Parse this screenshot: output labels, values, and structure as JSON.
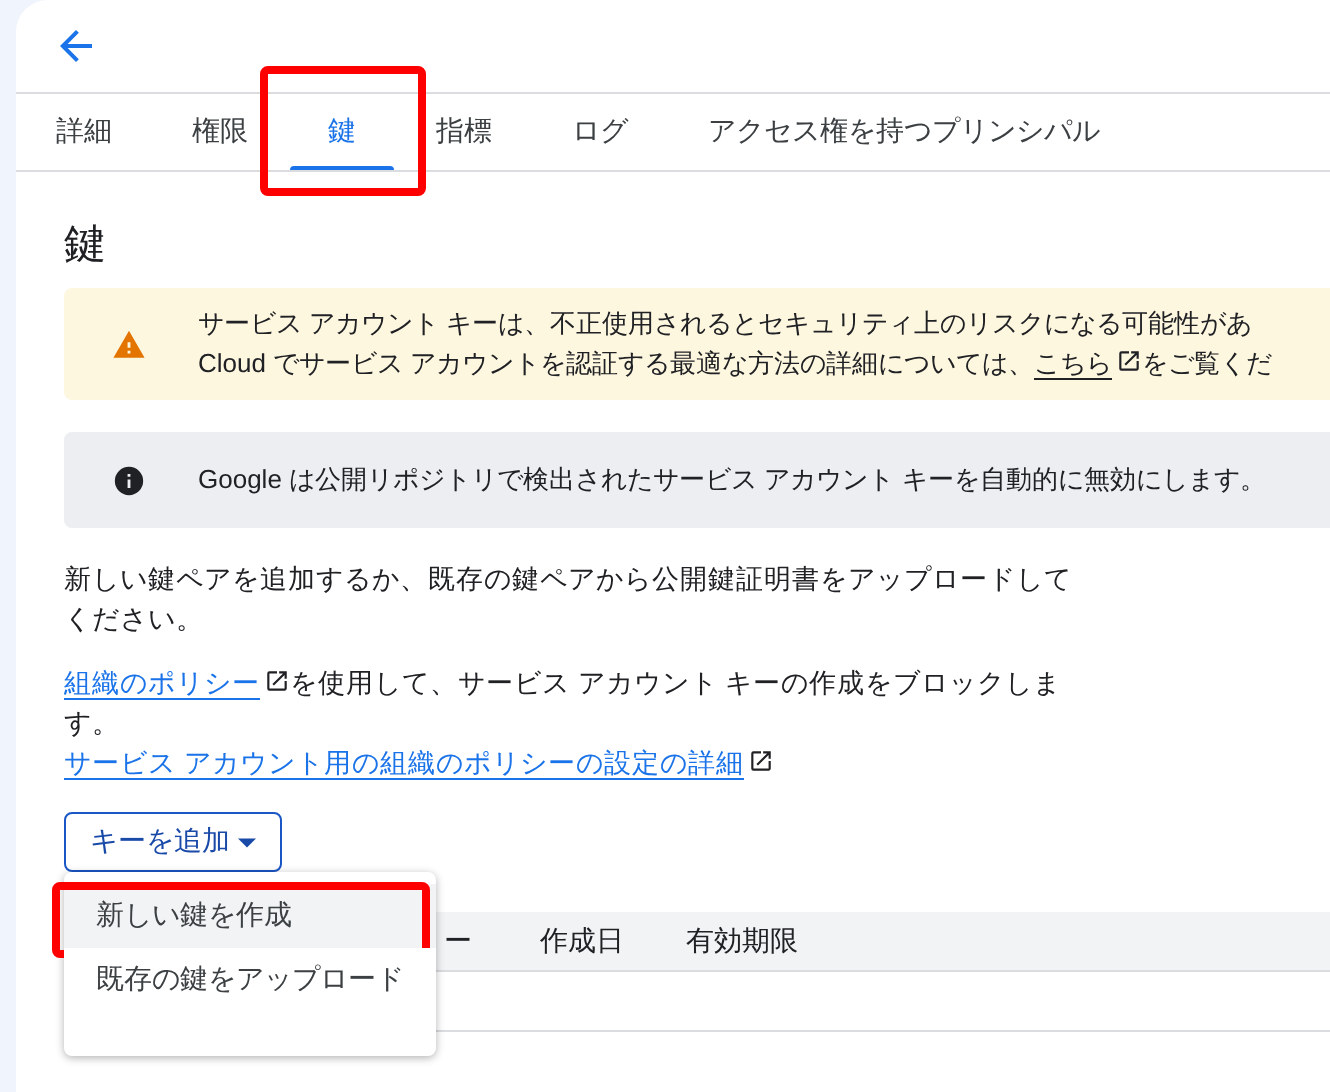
{
  "tabs": [
    {
      "label": "詳細",
      "selected": false,
      "highlighted": false
    },
    {
      "label": "権限",
      "selected": false,
      "highlighted": false
    },
    {
      "label": "鍵",
      "selected": true,
      "highlighted": true
    },
    {
      "label": "指標",
      "selected": false,
      "highlighted": false
    },
    {
      "label": "ログ",
      "selected": false,
      "highlighted": false
    },
    {
      "label": "アクセス権を持つプリンシパル",
      "selected": false,
      "highlighted": false
    }
  ],
  "heading": "鍵",
  "banners": [
    {
      "kind": "warning",
      "lines": [
        {
          "text": "サービス アカウント キーは、不正使用されるとセキュリティ上のリスクになる可能性があ"
        },
        {
          "text": "Cloud でサービス アカウントを認証する最適な方法の詳細については、",
          "link": "こちら",
          "after": "をご覧くだ"
        }
      ]
    },
    {
      "kind": "info",
      "lines": [
        {
          "text": "Google は公開リポジトリで検出されたサービス アカウント キーを自動的に無効にします。"
        }
      ]
    }
  ],
  "intro": "新しい鍵ペアを追加するか、既存の鍵ペアから公開鍵証明書をアップロードしてください。",
  "policy": {
    "link": "組織のポリシー",
    "text": "を使用して、サービス アカウント キーの作成をブロックします。",
    "details_link": "サービス アカウント用の組織のポリシーの設定の詳細"
  },
  "add_key_button": "キーを追加",
  "menu": [
    {
      "label": "新しい鍵を作成",
      "highlighted": true
    },
    {
      "label": "既存の鍵をアップロード",
      "highlighted": false
    }
  ],
  "table": {
    "columns": [
      "ー",
      "作成日",
      "有効期限"
    ]
  }
}
